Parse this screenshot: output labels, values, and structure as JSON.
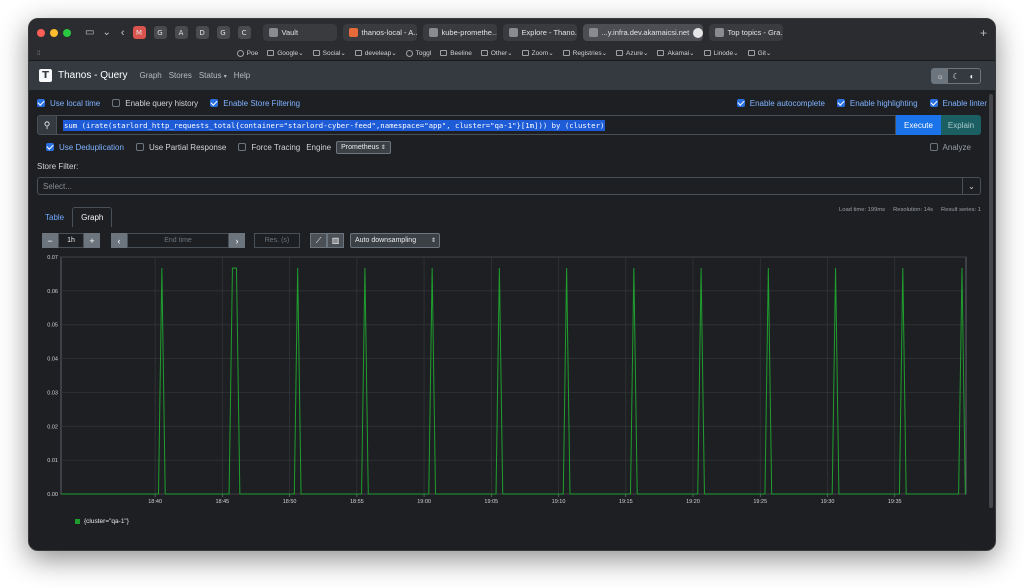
{
  "browser": {
    "traffic_colors": [
      "#ff5f57",
      "#febc2e",
      "#28c840"
    ],
    "pinned_tabs": [
      "G",
      "A",
      "D",
      "G",
      "C"
    ],
    "tabs": [
      {
        "label": "Vault",
        "active": false
      },
      {
        "label": "thanos-local - A...",
        "active": false
      },
      {
        "label": "kube-promethe...",
        "active": false
      },
      {
        "label": "Explore - Thano...",
        "active": false
      },
      {
        "label": "...y.infra.dev.akamaicsi.net",
        "active": true
      },
      {
        "label": "Top topics - Gra...",
        "active": false
      }
    ],
    "bookmarks": [
      "Poe",
      "Google",
      "Social",
      "develeap",
      "Toggl",
      "Beeline",
      "Other",
      "Zoom",
      "Registries",
      "Azure",
      "Akamai",
      "Linode",
      "Git"
    ]
  },
  "nav": {
    "brand": "Thanos - Query",
    "links": [
      "Graph",
      "Stores",
      "Status",
      "Help"
    ],
    "status_caret": "▾"
  },
  "options": {
    "use_local_time": "Use local time",
    "enable_query_history": "Enable query history",
    "enable_store_filtering": "Enable Store Filtering",
    "enable_autocomplete": "Enable autocomplete",
    "enable_highlighting": "Enable highlighting",
    "enable_linter": "Enable linter"
  },
  "query": {
    "expression": "sum (irate(starlord_http_requests_total{container=\"starlord-cyber-feed\",namespace=\"app\", cluster=\"qa-1\"}[1m])) by (cluster)",
    "execute_label": "Execute",
    "explain_label": "Explain"
  },
  "query_options": {
    "use_deduplication": "Use Deduplication",
    "use_partial_response": "Use Partial Response",
    "force_tracing": "Force Tracing",
    "engine_label": "Engine",
    "engine_value": "Prometheus",
    "analyze": "Analyze"
  },
  "store_filter": {
    "label": "Store Filter:",
    "placeholder": "Select..."
  },
  "panel_tabs": {
    "table": "Table",
    "graph": "Graph"
  },
  "stats": {
    "load_time": "Load time: 199ms",
    "resolution": "Resolution: 14s",
    "result_series": "Result series: 1"
  },
  "controls": {
    "minus": "−",
    "plus": "+",
    "range": "1h",
    "prev": "‹",
    "next": "›",
    "end_time_placeholder": "End time",
    "res_placeholder": "Res. (s)",
    "downsampling": "Auto downsampling"
  },
  "chart_data": {
    "type": "line",
    "y_ticks": [
      "0.07",
      "0.06",
      "0.05",
      "0.04",
      "0.03",
      "0.02",
      "0.01",
      "0.00"
    ],
    "ylim": [
      0,
      0.07
    ],
    "x_ticks": [
      "18:40",
      "18:45",
      "18:50",
      "18:55",
      "19:00",
      "19:05",
      "19:10",
      "19:15",
      "19:20",
      "19:25",
      "19:30",
      "19:35"
    ],
    "x_start_minutes": -7,
    "x_end_minutes": 60.3,
    "grid": true,
    "series": [
      {
        "name": "{cluster=\"qa-1\"}",
        "color": "#1f9e2e",
        "spike_value": 0.0667,
        "spike_center_minutes": [
          0.5,
          5.9,
          10.6,
          15.6,
          20.6,
          25.6,
          30.6,
          35.6,
          40.6,
          45.6,
          50.6,
          55.6,
          60.0
        ],
        "spike_widths_minutes": [
          0.5,
          0.5,
          0.5,
          0.5,
          0.5,
          0.5,
          0.5,
          0.5,
          0.5,
          0.5,
          0.5,
          0.5,
          0.5
        ],
        "plateau_width_minutes": [
          0,
          0.3,
          0,
          0,
          0,
          0,
          0,
          0,
          0,
          0,
          0,
          0,
          0
        ]
      }
    ]
  }
}
